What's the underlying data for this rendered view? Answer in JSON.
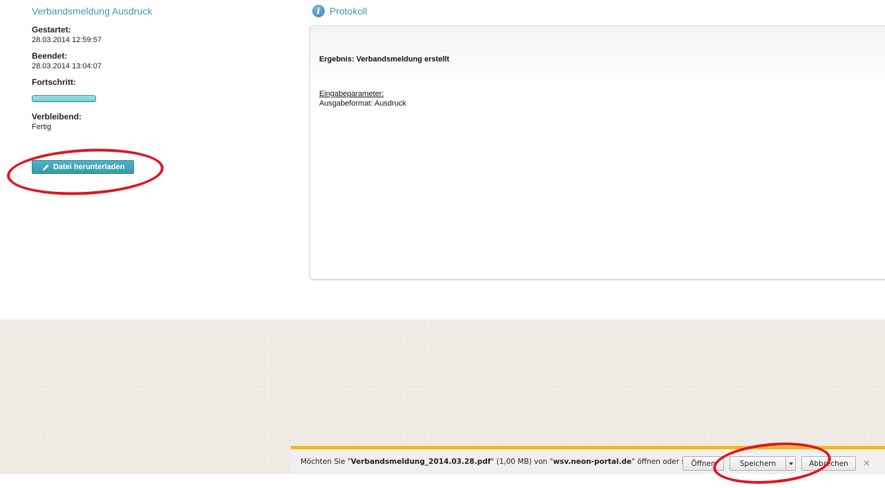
{
  "job": {
    "title": "Verbandsmeldung Ausdruck",
    "started_label": "Gestartet:",
    "started_value": "28.03.2014 12:59:57",
    "ended_label": "Beendet:",
    "ended_value": "28.03.2014 13:04:07",
    "progress_label": "Fortschritt:",
    "progress_fraction": 1.0,
    "remaining_label": "Verbleibend:",
    "remaining_value": "Fertig",
    "download_button": "Datei herunterladen",
    "download_icon": "pencil-icon"
  },
  "protocol": {
    "icon": "info-icon",
    "icon_glyph": "i",
    "title": "Protokoll",
    "result": "Ergebnis: Verbandsmeldung erstellt",
    "params_heading": "Eingabeparameter:",
    "params_value": "Ausgabeformat: Ausdruck"
  },
  "download_bar": {
    "msg_prefix": "Möchten Sie \"",
    "filename": "Verbandsmeldung_2014.03.28.pdf",
    "msg_middle1": "\" (1,00 MB) von \"",
    "host": "wsv.neon-portal.de",
    "msg_suffix": "\" öffnen oder speichern?",
    "open_button": "Öffnen",
    "save_button": "Speichern",
    "cancel_button": "Abbrechen",
    "close_glyph": "×",
    "accent_color": "#f2b81e"
  },
  "colors": {
    "accent": "#3a9ab0",
    "annotation": "#e0141e"
  }
}
